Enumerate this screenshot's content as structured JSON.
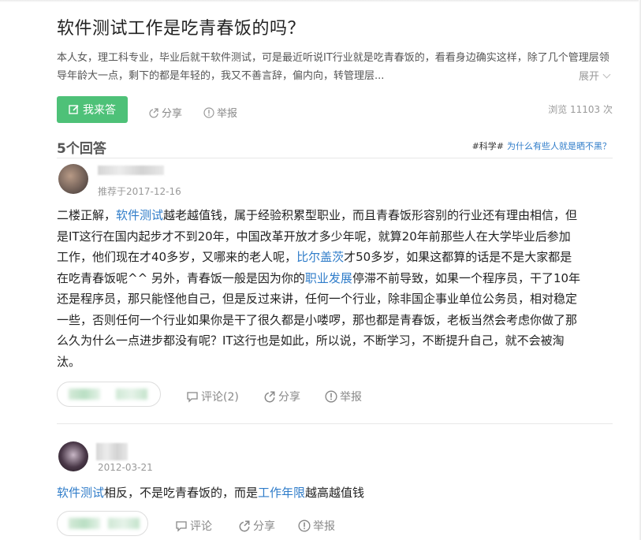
{
  "question": {
    "title": "软件测试工作是吃青春饭的吗？",
    "description": "本人女，理工科专业，毕业后就干软件测试，可是最近听说IT行业就是吃青春饭的，看看身边确实这样，除了几个管理层领导年龄大一点，剩下的都是年轻的，我又不善言辞，偏内向，转管理层...",
    "expand_label": "展开",
    "answer_button": "我来答",
    "share_label": "分享",
    "report_label": "举报",
    "views": "浏览 11103 次"
  },
  "answers_header": {
    "count": "5个回答",
    "topic_tag": "#科学#",
    "topic_link": "为什么有些人就是晒不黑？"
  },
  "answers": [
    {
      "date": "推荐于2017-12-16",
      "lines": [
        [
          "二楼正解，",
          "软件测试",
          "越老越值钱，属于经验积累型职业，而且青春饭形容别的行业还有理由相信，但"
        ],
        [
          "是IT这行在国内起步才不到20年，中国改革开放才多少年呢，就算20年前那些人在大学毕业后参加"
        ],
        [
          "工作，他们现在才40多岁，又哪来的老人呢，",
          "比尔盖茨",
          "才50多岁，如果这都算的话是不是大家都是"
        ],
        [
          "在吃青春饭呢^^ 另外，青春饭一般是因为你的",
          "职业发展",
          "停滞不前导致，如果一个程序员，干了10年"
        ],
        [
          "还是程序员，那只能怪他自己，但是反过来讲，任何一个行业，除非国企事业单位公务员，相对稳定"
        ],
        [
          "一些，否则任何一个行业如果你是干了很久都是小喽啰，那也都是青春饭，老板当然会考虑你做了那"
        ],
        [
          "么久为什么一点进步都没有呢？IT这行也是如此，所以说，不断学习，不断提升自己，就不会被淘"
        ],
        [
          "汰。"
        ]
      ],
      "comment_label": "评论(2)",
      "share_label": "分享",
      "report_label": "举报"
    },
    {
      "date": "2012-03-21",
      "lines": [
        [
          "",
          "软件测试",
          "相反，不是吃青春饭的，而是",
          "工作年限",
          "越高越值钱"
        ]
      ],
      "comment_label": "评论",
      "share_label": "分享",
      "report_label": "举报"
    }
  ],
  "colors": {
    "accent_green": "#4ec178",
    "link_blue": "#2f7cc9",
    "muted": "#999999"
  }
}
